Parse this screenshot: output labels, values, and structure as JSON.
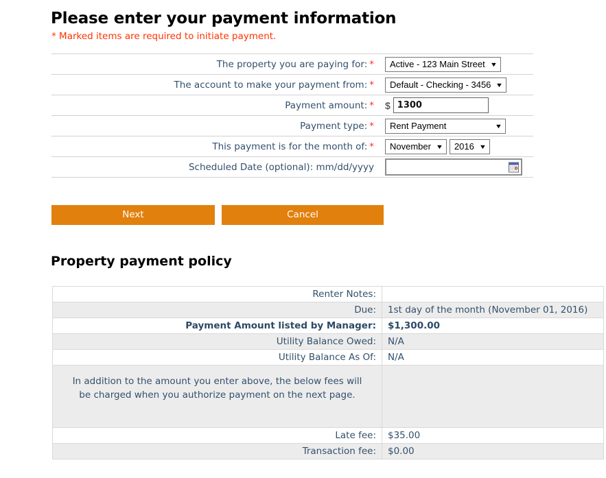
{
  "header": {
    "title": "Please enter your payment information",
    "required_note": "* Marked items are required to initiate payment.",
    "required_note_color": "#ff3300"
  },
  "form": {
    "fields": [
      {
        "label": "The property you are paying for:",
        "required": true,
        "type": "select",
        "value": "Active - 123 Main Street"
      },
      {
        "label": "The account to make your payment from:",
        "required": true,
        "type": "select",
        "value": "Default - Checking - 3456"
      },
      {
        "label": "Payment amount:",
        "required": true,
        "type": "text",
        "prefix": "$",
        "value": "1300",
        "placeholder": ""
      },
      {
        "label": "Payment type:",
        "required": true,
        "type": "select",
        "value": "Rent Payment"
      },
      {
        "label": "This payment is for the month of:",
        "required": true,
        "type": "select-pair",
        "month_value": "November",
        "year_value": "2016"
      },
      {
        "label": "Scheduled Date (optional):",
        "label_format": "mm/dd/yyyy",
        "required": false,
        "type": "date",
        "value": "",
        "placeholder": "",
        "icon": "calendar-icon"
      }
    ],
    "required_marker": "*"
  },
  "actions": {
    "next_label": "Next",
    "cancel_label": "Cancel",
    "button_color": "#e2800d"
  },
  "policy": {
    "title": "Property payment policy",
    "rows": [
      {
        "label": "Renter Notes:",
        "value": "",
        "shaded": false,
        "bold": false
      },
      {
        "label": "Due:",
        "value": "1st day of the month (November 01, 2016)",
        "shaded": true,
        "bold": false
      },
      {
        "label": "Payment Amount listed by Manager:",
        "value": "$1,300.00",
        "shaded": false,
        "bold": true
      },
      {
        "label": "Utility Balance Owed:",
        "value": "N/A",
        "shaded": true,
        "bold": false
      },
      {
        "label": "Utility Balance As Of:",
        "value": "N/A",
        "shaded": false,
        "bold": false
      },
      {
        "label": "In addition to the amount you enter above, the below fees will be charged when you authorize payment on the next page.",
        "value": "",
        "shaded": true,
        "bold": false,
        "note": true
      },
      {
        "label": "Late fee:",
        "value": "$35.00",
        "shaded": false,
        "bold": false
      },
      {
        "label": "Transaction fee:",
        "value": "$0.00",
        "shaded": true,
        "bold": false
      }
    ]
  }
}
